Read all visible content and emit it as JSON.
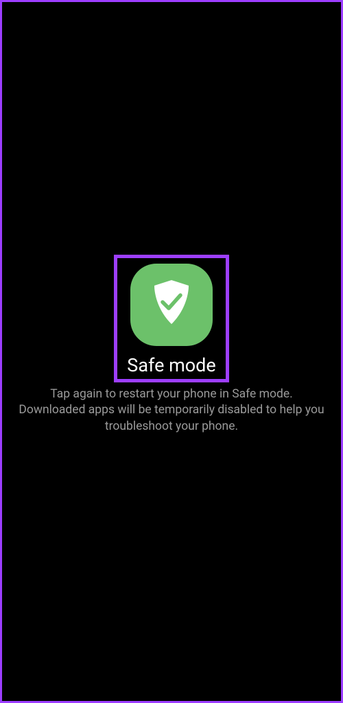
{
  "safemode": {
    "title": "Safe mode",
    "description": "Tap again to restart your phone in Safe mode. Downloaded apps will be temporarily disabled to help you troubleshoot your phone."
  }
}
